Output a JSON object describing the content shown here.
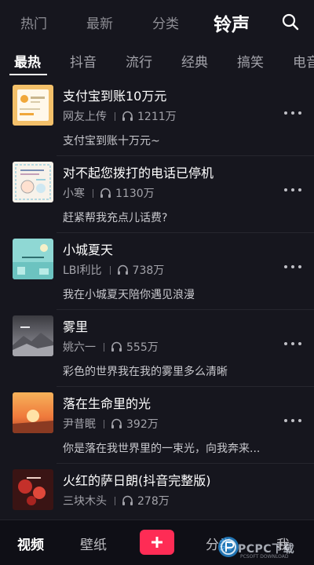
{
  "top_tabs": [
    "热门",
    "最新",
    "分类",
    "铃声"
  ],
  "active_top_tab": "铃声",
  "sub_tabs": [
    "最热",
    "抖音",
    "流行",
    "经典",
    "搞笑",
    "电音"
  ],
  "active_sub_tab": "最热",
  "ringtones": [
    {
      "title": "支付宝到账10万元",
      "author": "网友上传",
      "plays": "1211万",
      "desc": "支付宝到账十万元~",
      "thumb_icon": "alipay-receipt-thumb-icon"
    },
    {
      "title": "对不起您拨打的电话已停机",
      "author": "小寒",
      "plays": "1130万",
      "desc": "赶紧帮我充点儿话费?",
      "thumb_icon": "cartoon-note-thumb-icon"
    },
    {
      "title": "小城夏天",
      "author": "LBI利比",
      "plays": "738万",
      "desc": "我在小城夏天陪你遇见浪漫",
      "thumb_icon": "summer-town-thumb-icon"
    },
    {
      "title": "雾里",
      "author": "姚六一",
      "plays": "555万",
      "desc": "彩色的世界我在我的雾里多么清晰",
      "thumb_icon": "foggy-mountain-thumb-icon"
    },
    {
      "title": "落在生命里的光",
      "author": "尹昔眠",
      "plays": "392万",
      "desc": "你是落在我世界里的一束光，向我奔来...",
      "thumb_icon": "sunset-thumb-icon"
    },
    {
      "title": "火红的萨日朗(抖音完整版)",
      "author": "三块木头",
      "plays": "278万",
      "desc": "",
      "thumb_icon": "red-flower-thumb-icon"
    }
  ],
  "bottom_tabs": {
    "video": "视频",
    "wallpaper": "壁纸",
    "category": "分类",
    "me": "我"
  },
  "watermark": {
    "text": "PCPC下载",
    "sub": "PCSOFT DOWNLOAD"
  },
  "colors": {
    "background": "#16161e",
    "accent": "#fe2c55",
    "text_primary": "#ffffff",
    "text_secondary": "#a3a3aa"
  }
}
